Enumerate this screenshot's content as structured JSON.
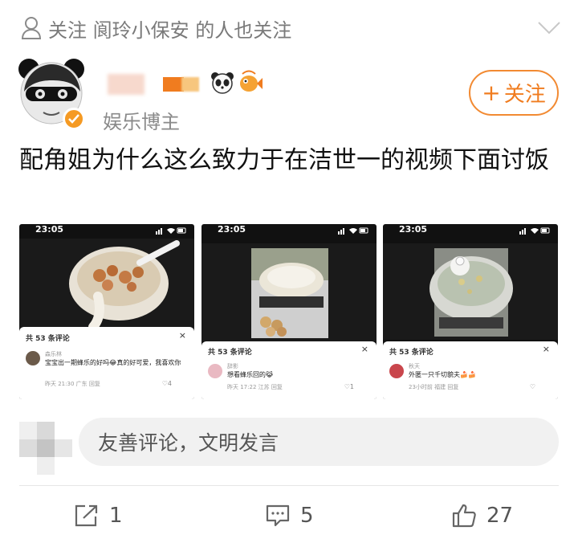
{
  "header": {
    "follow_hint": "关注 阆玲小保安 的人也关注"
  },
  "author": {
    "title": "娱乐博主",
    "follow_label": "关注",
    "follow_plus": "+"
  },
  "post": {
    "text": "配角姐为什么这么致力于在洁世一的视频下面讨饭"
  },
  "screenshots": [
    {
      "time": "23:05",
      "panel_title": "共 53 条评论",
      "close": "×",
      "commenter": "森乐林",
      "comment": "宝宝出一期蜂乐的好吗😂真的好可爱，我喜欢你",
      "meta": "昨天 21:30 广东  回复",
      "likes": "♡4"
    },
    {
      "time": "23:05",
      "panel_title": "共 53 条评论",
      "close": "×",
      "commenter": "辞影",
      "comment": "想看蜂乐回的😹",
      "meta": "昨天 17:22 江苏  回复",
      "likes": "♡1"
    },
    {
      "time": "23:05",
      "panel_title": "共 53 条评论",
      "close": "×",
      "commenter": "秋天",
      "comment": "外匿一只千切貌夫🍰🍰",
      "meta": "23小时前 福建  回复",
      "likes": "♡"
    }
  ],
  "comment_box": {
    "placeholder": "友善评论，文明发言"
  },
  "actions": {
    "share_count": "1",
    "comment_count": "5",
    "like_count": "27"
  },
  "colors": {
    "accent": "#f07c1f",
    "verify": "#f59a23",
    "muted": "#7a7a7a"
  }
}
